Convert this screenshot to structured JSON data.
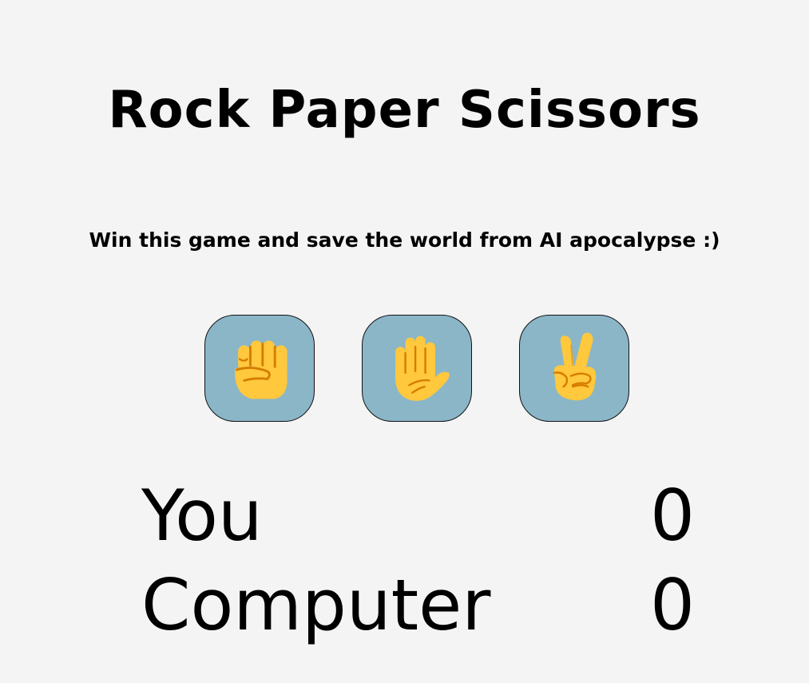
{
  "title": "Rock Paper Scissors",
  "subtitle": "Win this game and save the world from AI apocalypse :)",
  "choices": [
    {
      "id": "rock",
      "icon": "raised-fist-icon"
    },
    {
      "id": "paper",
      "icon": "raised-hand-icon"
    },
    {
      "id": "scissors",
      "icon": "victory-hand-icon"
    }
  ],
  "score": {
    "player_label": "You",
    "player_value": "0",
    "computer_label": "Computer",
    "computer_value": "0"
  },
  "colors": {
    "background": "#f4f4f4",
    "button_fill": "#8ab6c8",
    "emoji_skin": "#ffc83d",
    "emoji_shadow": "#d67d00"
  }
}
